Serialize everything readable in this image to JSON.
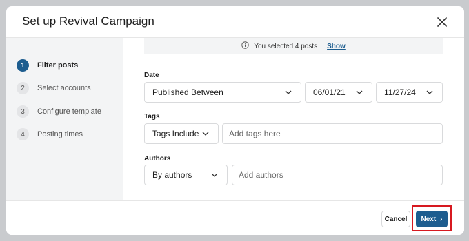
{
  "modal": {
    "title": "Set up Revival Campaign"
  },
  "steps": [
    {
      "num": "1",
      "label": "Filter posts",
      "active": true
    },
    {
      "num": "2",
      "label": "Select accounts",
      "active": false
    },
    {
      "num": "3",
      "label": "Configure template",
      "active": false
    },
    {
      "num": "4",
      "label": "Posting times",
      "active": false
    }
  ],
  "selection": {
    "text": "You selected 4 posts",
    "show_label": "Show"
  },
  "date": {
    "label": "Date",
    "mode": "Published Between",
    "start": "06/01/21",
    "end": "11/27/24"
  },
  "tags": {
    "label": "Tags",
    "mode": "Tags Include",
    "placeholder": "Add tags here"
  },
  "authors": {
    "label": "Authors",
    "mode": "By authors",
    "placeholder": "Add authors"
  },
  "footer": {
    "cancel_label": "Cancel",
    "next_label": "Next",
    "next_arrow": "›"
  },
  "colors": {
    "accent": "#1d5d8f",
    "highlight": "#d71920"
  }
}
